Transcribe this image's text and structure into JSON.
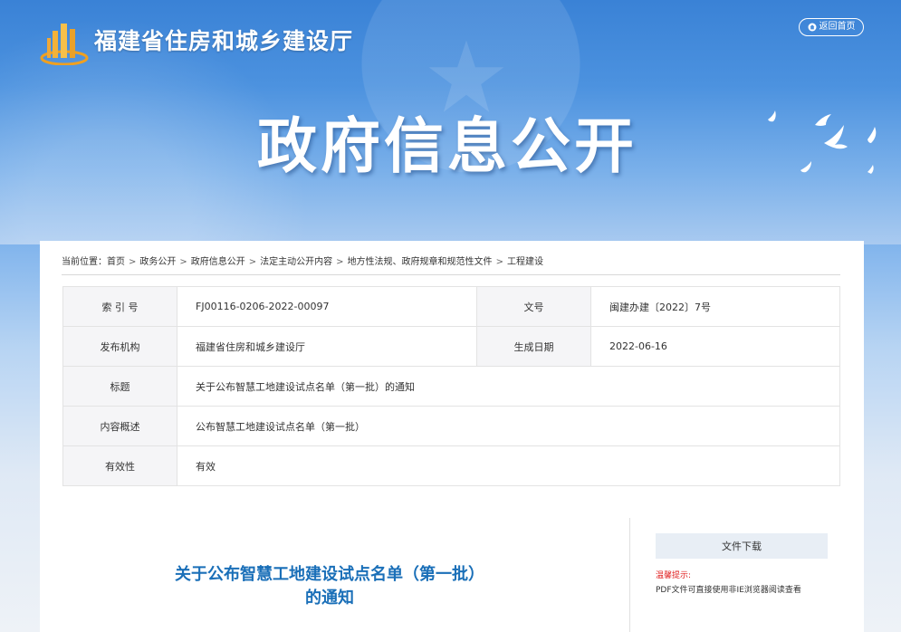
{
  "header": {
    "site_title": "福建省住房和城乡建设厅",
    "home_button": "返回首页",
    "banner_title": "政府信息公开"
  },
  "breadcrumb": {
    "prefix": "当前位置：",
    "items": [
      "首页",
      "政务公开",
      "政府信息公开",
      "法定主动公开内容",
      "地方性法规、政府规章和规范性文件",
      "工程建设"
    ],
    "separator": ">"
  },
  "meta": {
    "index_label": "索 引 号",
    "index_value": "FJ00116-0206-2022-00097",
    "docno_label": "文号",
    "docno_value": "闽建办建〔2022〕7号",
    "publisher_label": "发布机构",
    "publisher_value": "福建省住房和城乡建设厅",
    "date_label": "生成日期",
    "date_value": "2022-06-16",
    "title_label": "标题",
    "title_value": "关于公布智慧工地建设试点名单（第一批）的通知",
    "summary_label": "内容概述",
    "summary_value": "公布智慧工地建设试点名单（第一批）",
    "validity_label": "有效性",
    "validity_value": "有效"
  },
  "document": {
    "title_line1": "关于公布智慧工地建设试点名单（第一批）",
    "title_line2": "的通知"
  },
  "sidebar": {
    "download_button": "文件下载",
    "tip_label": "温馨提示:",
    "tip_text": "PDF文件可直接使用非IE浏览器阅读查看"
  },
  "colors": {
    "title_blue": "#1a6fb8",
    "tip_red": "#e02020"
  }
}
